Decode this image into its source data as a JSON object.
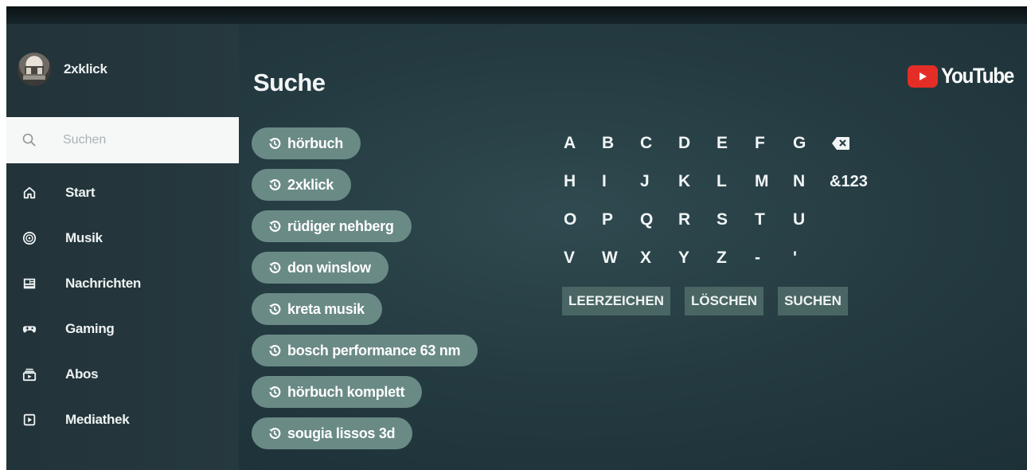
{
  "user": {
    "name": "2xklick"
  },
  "search": {
    "placeholder": "Suchen",
    "icon": "search-icon"
  },
  "nav": [
    {
      "label": "Start",
      "icon": "home-icon"
    },
    {
      "label": "Musik",
      "icon": "music-icon"
    },
    {
      "label": "Nachrichten",
      "icon": "news-icon"
    },
    {
      "label": "Gaming",
      "icon": "gaming-icon"
    },
    {
      "label": "Abos",
      "icon": "subscriptions-icon"
    },
    {
      "label": "Mediathek",
      "icon": "library-icon"
    }
  ],
  "main": {
    "title": "Suche",
    "history": [
      "hörbuch",
      "2xklick",
      "rüdiger nehberg",
      "don winslow",
      "kreta musik",
      "bosch performance 63 nm",
      "hörbuch komplett",
      "sougia lissos 3d"
    ]
  },
  "keyboard": {
    "rows": [
      [
        "A",
        "B",
        "C",
        "D",
        "E",
        "F",
        "G"
      ],
      [
        "H",
        "I",
        "J",
        "K",
        "L",
        "M",
        "N",
        "&123"
      ],
      [
        "O",
        "P",
        "Q",
        "R",
        "S",
        "T",
        "U"
      ],
      [
        "V",
        "W",
        "X",
        "Y",
        "Z",
        "-",
        "'"
      ]
    ],
    "actions": [
      "LEERZEICHEN",
      "LÖSCHEN",
      "SUCHEN"
    ]
  },
  "brand": {
    "wordmark": "YouTube",
    "color": "#e52d27"
  },
  "colors": {
    "chip": "#6a8a86",
    "background": "#243b41",
    "action": "#4a6664"
  }
}
